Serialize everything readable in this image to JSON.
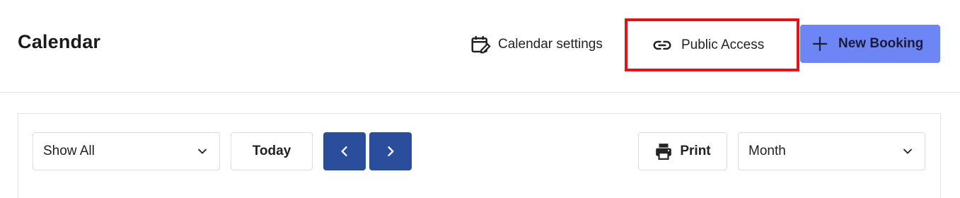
{
  "header": {
    "title": "Calendar",
    "calendar_settings": {
      "label": "Calendar settings",
      "icon": "calendar-edit-icon"
    },
    "public_access": {
      "label": "Public Access",
      "icon": "link-icon"
    },
    "new_booking": {
      "label": "New Booking",
      "icon": "plus-icon"
    }
  },
  "toolbar": {
    "filter": {
      "selected": "Show All",
      "icon": "chevron-down-icon"
    },
    "today_label": "Today",
    "prev_icon": "chevron-left-icon",
    "next_icon": "chevron-right-icon",
    "print": {
      "label": "Print",
      "icon": "printer-icon"
    },
    "view": {
      "selected": "Month",
      "icon": "chevron-down-icon"
    }
  },
  "colors": {
    "primary_button": "#6e85f5",
    "nav_button": "#2a4e9c",
    "highlight_border": "#e0141c"
  }
}
